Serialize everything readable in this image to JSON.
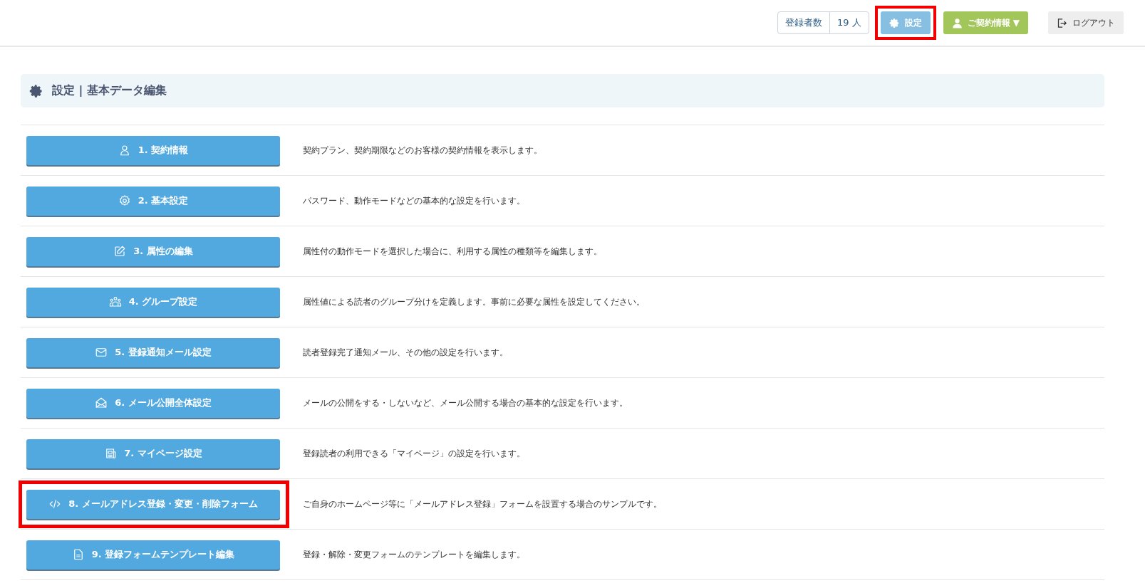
{
  "header": {
    "subscriber_count": {
      "label": "登録者数",
      "value": "19 人"
    },
    "buttons": [
      {
        "kind": "settings",
        "label": "設定",
        "highlighted": true
      },
      {
        "kind": "account",
        "label": "ご契約情報 ▼",
        "highlighted": false
      },
      {
        "kind": "logout",
        "label": "ログアウト",
        "highlighted": false
      }
    ]
  },
  "panel": {
    "title": "設定 | 基本データ編集"
  },
  "rows": [
    {
      "kind": "person",
      "label": "1. 契約情報",
      "description": "契約プラン、契約期限などのお客様の契約情報を表示します。",
      "highlighted": false
    },
    {
      "kind": "gear",
      "label": "2. 基本設定",
      "description": "パスワード、動作モードなどの基本的な設定を行います。",
      "highlighted": false
    },
    {
      "kind": "edit",
      "label": "3. 属性の編集",
      "description": "属性付の動作モードを選択した場合に、利用する属性の種類等を編集します。",
      "highlighted": false
    },
    {
      "kind": "group",
      "label": "4. グループ設定",
      "description": "属性値による読者のグループ分けを定義します。事前に必要な属性を設定してください。",
      "highlighted": false
    },
    {
      "kind": "mail",
      "label": "5. 登録通知メール設定",
      "description": "読者登録完了通知メール、その他の設定を行います。",
      "highlighted": false
    },
    {
      "kind": "mail-open",
      "label": "6. メール公開全体設定",
      "description": "メールの公開をする・しないなど、メール公開する場合の基本的な設定を行います。",
      "highlighted": false
    },
    {
      "kind": "news",
      "label": "7. マイページ設定",
      "description": "登録読者の利用できる「マイページ」の設定を行います。",
      "highlighted": false
    },
    {
      "kind": "code",
      "label": "8. メールアドレス登録・変更・削除フォーム",
      "description": "ご自身のホームページ等に「メールアドレス登録」フォームを設置する場合のサンプルです。",
      "highlighted": true
    },
    {
      "kind": "document",
      "label": "9. 登録フォームテンプレート編集",
      "description": "登録・解除・変更フォームのテンプレートを編集します。",
      "highlighted": false
    }
  ]
}
